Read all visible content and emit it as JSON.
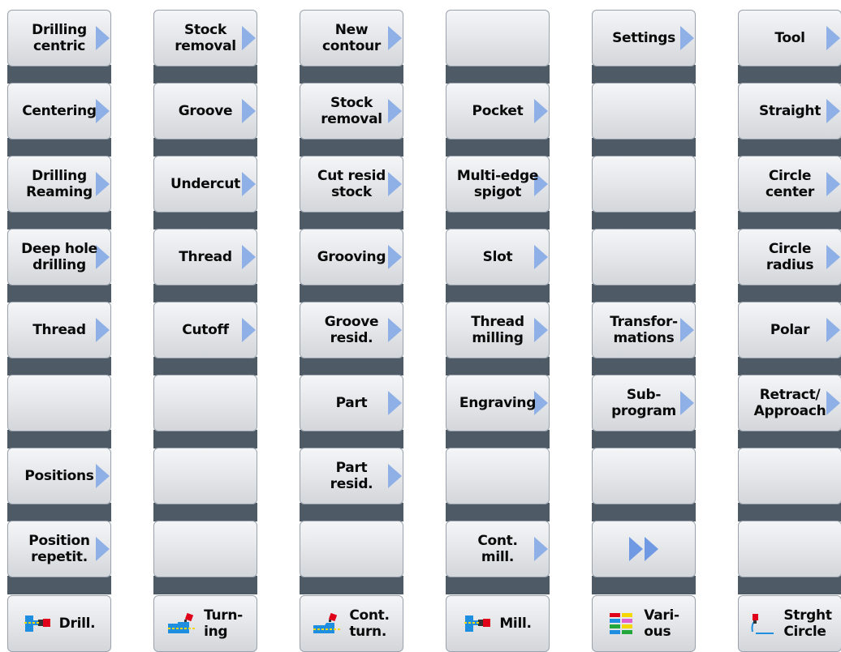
{
  "columns": [
    {
      "id": "drill",
      "softkeys": [
        {
          "label": "Drilling\ncentric",
          "arrow": true
        },
        {
          "label": "Centering",
          "arrow": true
        },
        {
          "label": "Drilling\nReaming",
          "arrow": true
        },
        {
          "label": "Deep hole\ndrilling",
          "arrow": true
        },
        {
          "label": "Thread",
          "arrow": true
        },
        {
          "label": "",
          "arrow": false
        },
        {
          "label": "Positions",
          "arrow": true
        },
        {
          "label": "Position\nrepetit.",
          "arrow": true
        }
      ],
      "hardkey": {
        "label": "Drill.",
        "icon": "drill-icon"
      }
    },
    {
      "id": "turning",
      "softkeys": [
        {
          "label": "Stock\nremoval",
          "arrow": true
        },
        {
          "label": "Groove",
          "arrow": true
        },
        {
          "label": "Undercut",
          "arrow": true
        },
        {
          "label": "Thread",
          "arrow": true
        },
        {
          "label": "Cutoff",
          "arrow": true
        },
        {
          "label": "",
          "arrow": false
        },
        {
          "label": "",
          "arrow": false
        },
        {
          "label": "",
          "arrow": false
        }
      ],
      "hardkey": {
        "label": "Turn-\ning",
        "icon": "turning-icon"
      }
    },
    {
      "id": "contour-turning",
      "softkeys": [
        {
          "label": "New\ncontour",
          "arrow": true
        },
        {
          "label": "Stock\nremoval",
          "arrow": true
        },
        {
          "label": "Cut resid\nstock",
          "arrow": true
        },
        {
          "label": "Grooving",
          "arrow": true
        },
        {
          "label": "Groove\nresid.",
          "arrow": true
        },
        {
          "label": "Part",
          "arrow": true
        },
        {
          "label": "Part\nresid.",
          "arrow": true
        },
        {
          "label": "",
          "arrow": false
        }
      ],
      "hardkey": {
        "label": "Cont.\nturn.",
        "icon": "contour-turning-icon"
      }
    },
    {
      "id": "milling",
      "softkeys": [
        {
          "label": "",
          "arrow": false
        },
        {
          "label": "Pocket",
          "arrow": true
        },
        {
          "label": "Multi-edge\nspigot",
          "arrow": true
        },
        {
          "label": "Slot",
          "arrow": true
        },
        {
          "label": "Thread\nmilling",
          "arrow": true
        },
        {
          "label": "Engraving",
          "arrow": true
        },
        {
          "label": "",
          "arrow": false
        },
        {
          "label": "Cont.\nmill.",
          "arrow": true
        }
      ],
      "hardkey": {
        "label": "Mill.",
        "icon": "mill-icon"
      }
    },
    {
      "id": "various",
      "softkeys": [
        {
          "label": "Settings",
          "arrow": true
        },
        {
          "label": "",
          "arrow": false
        },
        {
          "label": "",
          "arrow": false
        },
        {
          "label": "",
          "arrow": false
        },
        {
          "label": "Transfor-\nmations",
          "arrow": true
        },
        {
          "label": "Sub-\nprogram",
          "arrow": true
        },
        {
          "label": "",
          "arrow": false
        },
        {
          "label": "",
          "arrow": false,
          "double_arrow": true
        }
      ],
      "hardkey": {
        "label": "Vari-\nous",
        "icon": "various-icon"
      }
    },
    {
      "id": "straight-circle",
      "softkeys": [
        {
          "label": "Tool",
          "arrow": true
        },
        {
          "label": "Straight",
          "arrow": true
        },
        {
          "label": "Circle\ncenter",
          "arrow": true
        },
        {
          "label": "Circle\nradius",
          "arrow": true
        },
        {
          "label": "Polar",
          "arrow": true
        },
        {
          "label": "Retract/\nApproach",
          "arrow": true
        },
        {
          "label": "",
          "arrow": false
        },
        {
          "label": "",
          "arrow": false
        }
      ],
      "hardkey": {
        "label": "Strght\nCircle",
        "icon": "straight-circle-icon"
      }
    }
  ],
  "colors": {
    "arrow": "#8fb0e6",
    "band": "#4e5a66",
    "accent_red": "#e0001a",
    "accent_blue": "#1e8fe0"
  }
}
